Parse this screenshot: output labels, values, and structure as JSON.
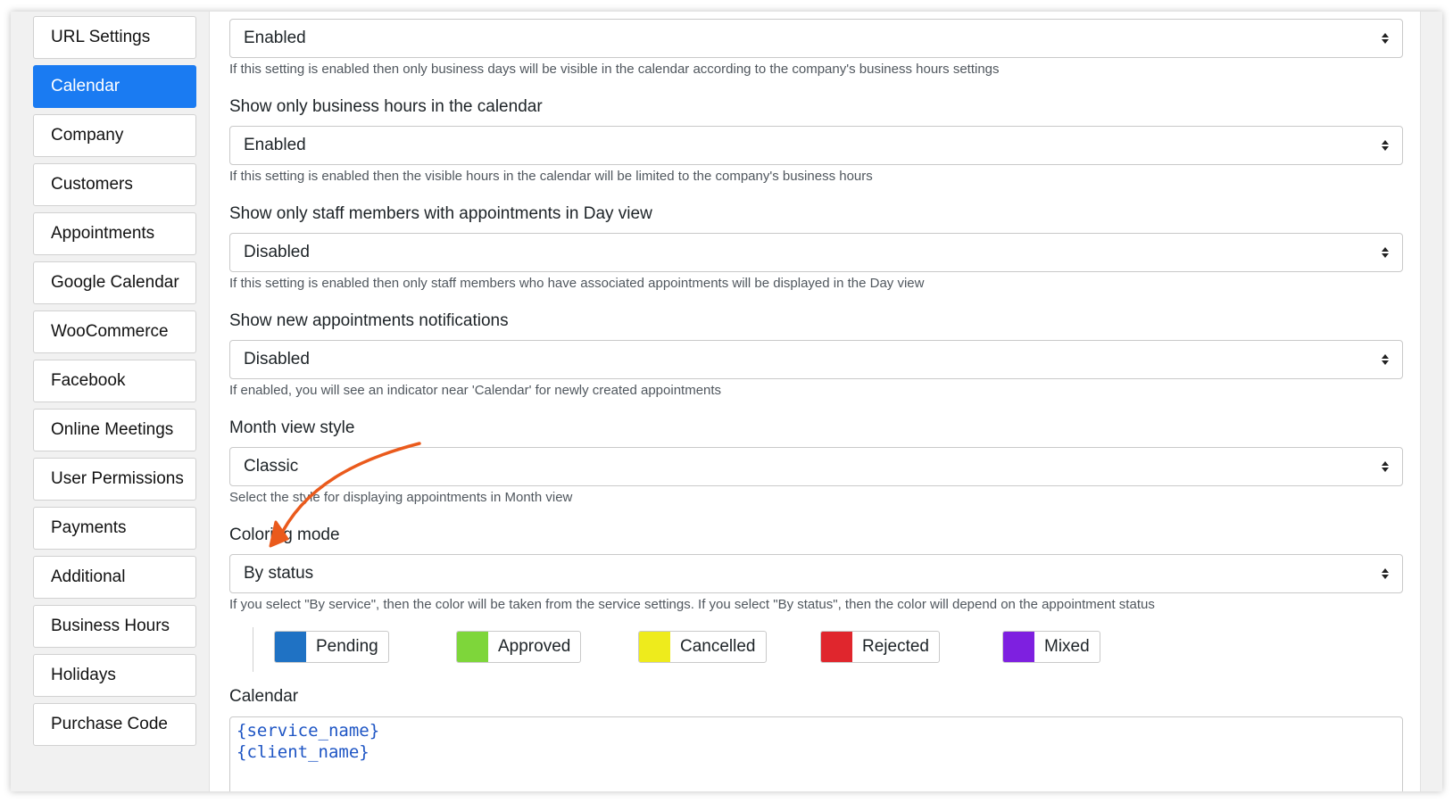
{
  "sidebar": {
    "items": [
      {
        "label": "URL Settings"
      },
      {
        "label": "Calendar"
      },
      {
        "label": "Company"
      },
      {
        "label": "Customers"
      },
      {
        "label": "Appointments"
      },
      {
        "label": "Google Calendar"
      },
      {
        "label": "WooCommerce"
      },
      {
        "label": "Facebook"
      },
      {
        "label": "Online Meetings"
      },
      {
        "label": "User Permissions"
      },
      {
        "label": "Payments"
      },
      {
        "label": "Additional"
      },
      {
        "label": "Business Hours"
      },
      {
        "label": "Holidays"
      },
      {
        "label": "Purchase Code"
      }
    ],
    "active_item": "Calendar"
  },
  "settings": [
    {
      "label": "",
      "value": "Enabled",
      "help": "If this setting is enabled then only business days will be visible in the calendar according to the company's business hours settings"
    },
    {
      "label": "Show only business hours in the calendar",
      "value": "Enabled",
      "help": "If this setting is enabled then the visible hours in the calendar will be limited to the company's business hours"
    },
    {
      "label": "Show only staff members with appointments in Day view",
      "value": "Disabled",
      "help": "If this setting is enabled then only staff members who have associated appointments will be displayed in the Day view"
    },
    {
      "label": "Show new appointments notifications",
      "value": "Disabled",
      "help": "If enabled, you will see an indicator near 'Calendar' for newly created appointments"
    },
    {
      "label": "Month view style",
      "value": "Classic",
      "help": "Select the style for displaying appointments in Month view"
    },
    {
      "label": "Coloring mode",
      "value": "By status",
      "help": "If you select \"By service\", then the color will be taken from the service settings. If you select \"By status\", then the color will depend on the appointment status"
    }
  ],
  "status_colors": [
    {
      "label": "Pending",
      "color": "#1f72c4"
    },
    {
      "label": "Approved",
      "color": "#7ed63a"
    },
    {
      "label": "Cancelled",
      "color": "#eeeb1c"
    },
    {
      "label": "Rejected",
      "color": "#e0262d"
    },
    {
      "label": "Mixed",
      "color": "#7e20e0"
    }
  ],
  "calendar_template": {
    "label": "Calendar",
    "lines": [
      "{service_name}",
      "{client_name}"
    ]
  },
  "colors": {
    "accent": "#1a7bf2",
    "annotation_arrow": "#ea5a1c"
  }
}
